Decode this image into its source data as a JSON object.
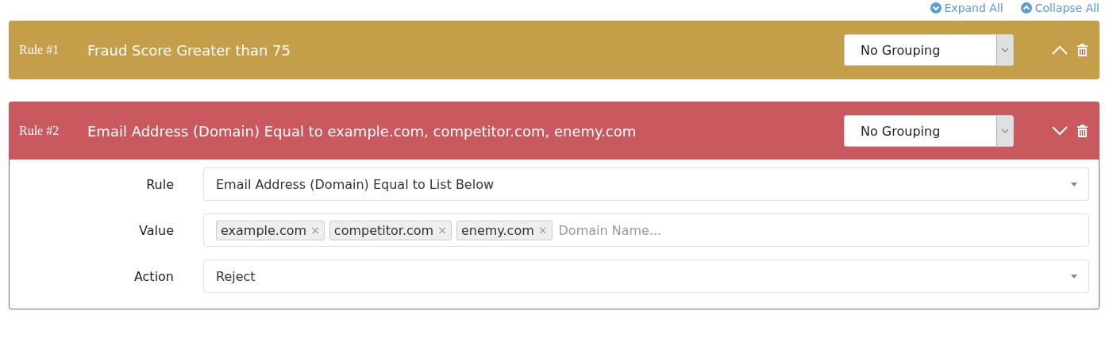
{
  "toolbar": [
    {
      "kind": "expand",
      "label": "Expand All"
    },
    {
      "kind": "collapse",
      "label": "Collapse All"
    }
  ],
  "rules": [
    {
      "number": "Rule #1",
      "title": "Fraud Score Greater than 75",
      "color": "#c49e48",
      "grouping": "No Grouping",
      "expanded": false
    },
    {
      "number": "Rule #2",
      "title": "Email Address (Domain) Equal to example.com, competitor.com, enemy.com",
      "color": "#c9595e",
      "grouping": "No Grouping",
      "expanded": true,
      "fields": [
        {
          "kind": "select",
          "label": "Rule",
          "value": "Email Address (Domain) Equal to List Below"
        },
        {
          "kind": "tags",
          "label": "Value",
          "tags": [
            {
              "text": "example.com",
              "remove": "×"
            },
            {
              "text": "competitor.com",
              "remove": "×"
            },
            {
              "text": "enemy.com",
              "remove": "×"
            }
          ],
          "placeholder": "Domain Name..."
        },
        {
          "kind": "select",
          "label": "Action",
          "value": "Reject"
        }
      ]
    }
  ]
}
